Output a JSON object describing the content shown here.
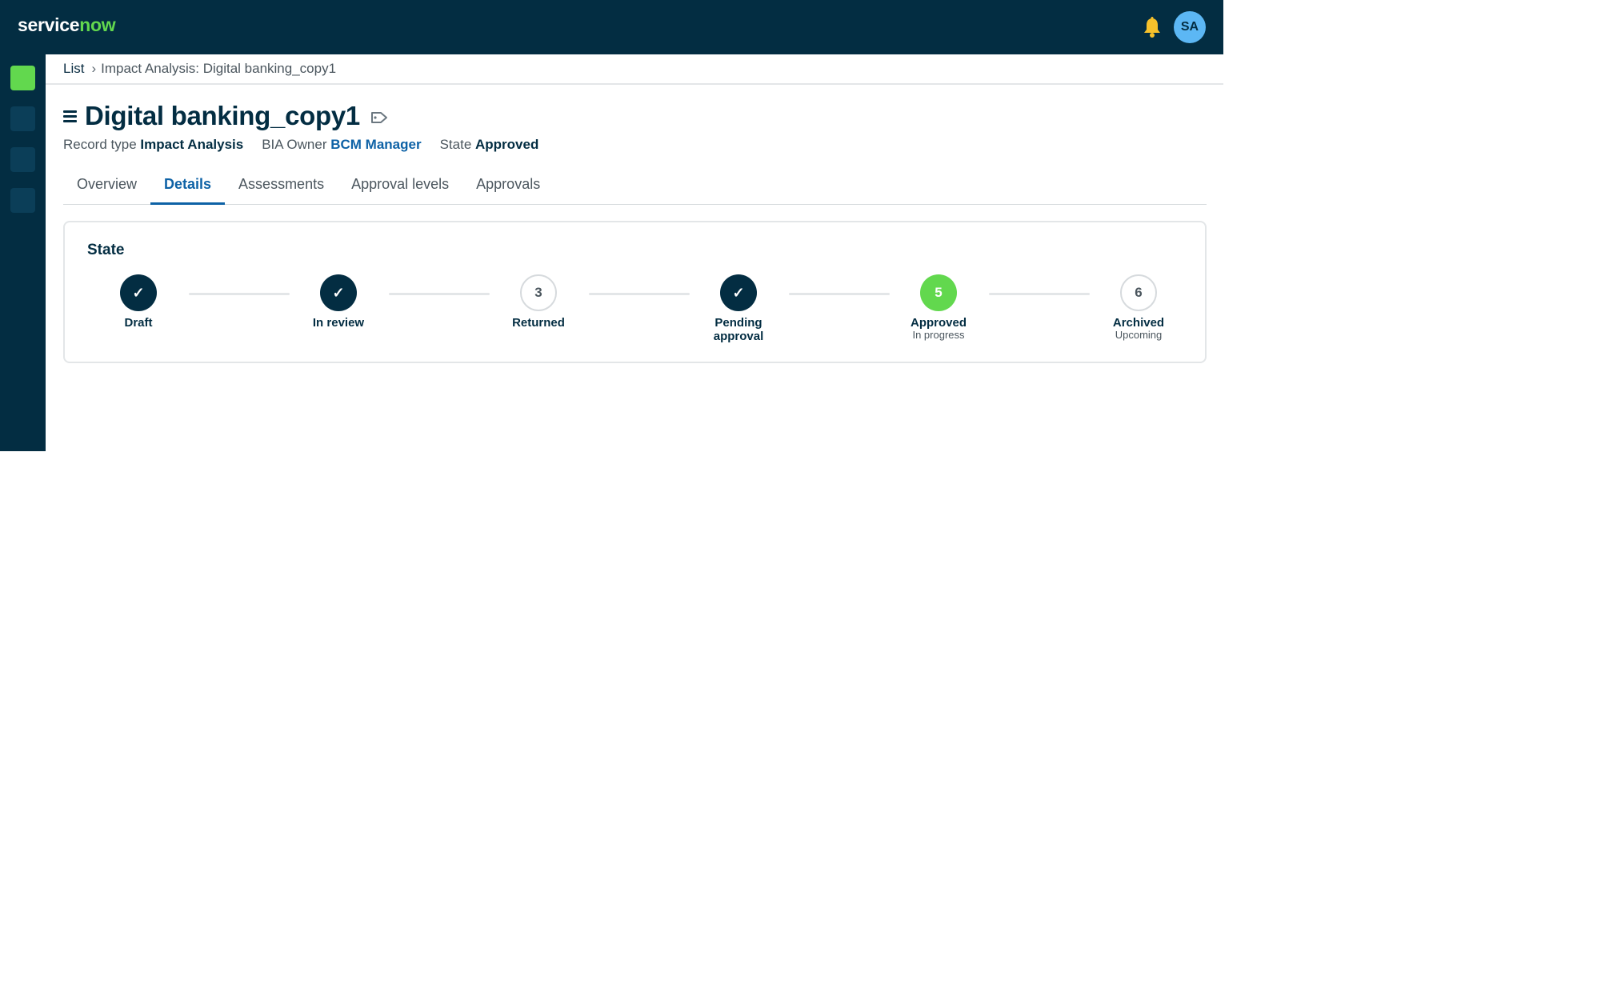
{
  "header": {
    "logo_part1": "service",
    "logo_part2": "now",
    "avatar_initials": "SA"
  },
  "breadcrumb": {
    "list_link": "List",
    "separator": "›",
    "current": "Impact Analysis: Digital banking_copy1"
  },
  "record": {
    "title": "Digital banking_copy1",
    "meta": [
      {
        "label": "Record type",
        "value": "Impact Analysis"
      },
      {
        "label": "BIA Owner",
        "value": "BCM Manager"
      },
      {
        "label": "State",
        "value": "Approved"
      }
    ]
  },
  "tabs": [
    "Overview",
    "Details",
    "Assessments",
    "Approval levels",
    "Approvals"
  ],
  "active_tab": "Details",
  "state_card": {
    "title": "State",
    "steps": [
      {
        "marker": "✓",
        "status": "complete",
        "label": "Draft",
        "sub": ""
      },
      {
        "marker": "✓",
        "status": "complete",
        "label": "In review",
        "sub": ""
      },
      {
        "marker": "3",
        "status": "upcoming",
        "label": "Returned",
        "sub": ""
      },
      {
        "marker": "✓",
        "status": "complete",
        "label": "Pending approval",
        "sub": ""
      },
      {
        "marker": "5",
        "status": "current",
        "label": "Approved",
        "sub": "In progress"
      },
      {
        "marker": "6",
        "status": "upcoming",
        "label": "Archived",
        "sub": "Upcoming"
      }
    ]
  },
  "colors": {
    "primary_dark": "#032d42",
    "accent_green": "#62d84e",
    "link_blue": "#0e62a6",
    "avatar_blue": "#5cb7f4"
  }
}
